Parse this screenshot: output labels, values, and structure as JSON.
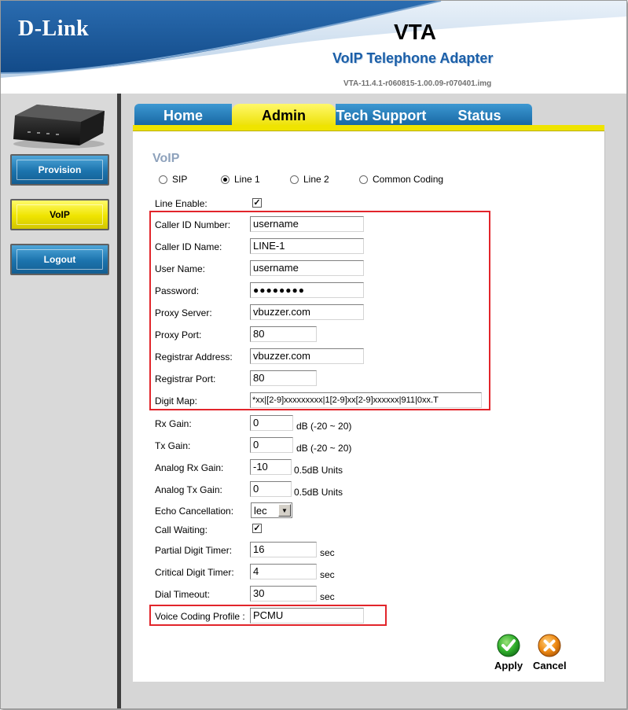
{
  "header": {
    "brand": "D-Link",
    "product": "VTA",
    "product_subtitle": "VoIP Telephone Adapter",
    "firmware": "VTA-11.4.1-r060815-1.00.09-r070401.img"
  },
  "sidebar": {
    "items": [
      {
        "label": "Provision",
        "active": false
      },
      {
        "label": "VoIP",
        "active": true
      },
      {
        "label": "Logout",
        "active": false
      }
    ]
  },
  "tabs": [
    {
      "label": "Home",
      "active": false
    },
    {
      "label": "Admin",
      "active": true
    },
    {
      "label": "Tech Support",
      "active": false
    },
    {
      "label": "Status",
      "active": false
    }
  ],
  "section_title": "VoIP",
  "radios": [
    {
      "label": "SIP",
      "selected": false
    },
    {
      "label": "Line 1",
      "selected": true
    },
    {
      "label": "Line 2",
      "selected": false
    },
    {
      "label": "Common Coding",
      "selected": false
    }
  ],
  "fields": {
    "line_enable": {
      "label": "Line Enable:",
      "checked": true
    },
    "caller_id_number": {
      "label": "Caller ID Number:",
      "value": "username"
    },
    "caller_id_name": {
      "label": "Caller ID Name:",
      "value": "LINE-1"
    },
    "user_name": {
      "label": "User Name:",
      "value": "username"
    },
    "password": {
      "label": "Password:",
      "value": "●●●●●●●●"
    },
    "proxy_server": {
      "label": "Proxy Server:",
      "value": "vbuzzer.com"
    },
    "proxy_port": {
      "label": "Proxy Port:",
      "value": "80"
    },
    "registrar_address": {
      "label": "Registrar Address:",
      "value": "vbuzzer.com"
    },
    "registrar_port": {
      "label": "Registrar Port:",
      "value": "80"
    },
    "digit_map": {
      "label": "Digit Map:",
      "value": "*xx|[2-9]xxxxxxxxx|1[2-9]xx[2-9]xxxxxx|911|0xx.T"
    },
    "rx_gain": {
      "label": "Rx Gain:",
      "value": "0",
      "unit": "dB (-20 ~ 20)"
    },
    "tx_gain": {
      "label": "Tx Gain:",
      "value": "0",
      "unit": "dB (-20 ~ 20)"
    },
    "analog_rx_gain": {
      "label": "Analog Rx Gain:",
      "value": "-10",
      "unit": "0.5dB Units"
    },
    "analog_tx_gain": {
      "label": "Analog Tx Gain:",
      "value": "0",
      "unit": "0.5dB Units"
    },
    "echo_cancellation": {
      "label": "Echo Cancellation:",
      "value": "lec"
    },
    "call_waiting": {
      "label": "Call Waiting:",
      "checked": true
    },
    "partial_digit_timer": {
      "label": "Partial Digit Timer:",
      "value": "16",
      "unit": "sec"
    },
    "critical_digit_timer": {
      "label": "Critical Digit Timer:",
      "value": "4",
      "unit": "sec"
    },
    "dial_timeout": {
      "label": "Dial Timeout:",
      "value": "30",
      "unit": "sec"
    },
    "voice_coding_profile": {
      "label": "Voice Coding Profile :",
      "value": "PCMU"
    }
  },
  "actions": {
    "apply": "Apply",
    "cancel": "Cancel"
  },
  "colors": {
    "header_blue": "#1f5fa0",
    "tab_blue": "#1b6fae",
    "tab_active_yellow": "#efe400",
    "highlight_red": "#e2252b",
    "apply_green": "#2fae2a",
    "cancel_orange": "#ee8a14"
  }
}
